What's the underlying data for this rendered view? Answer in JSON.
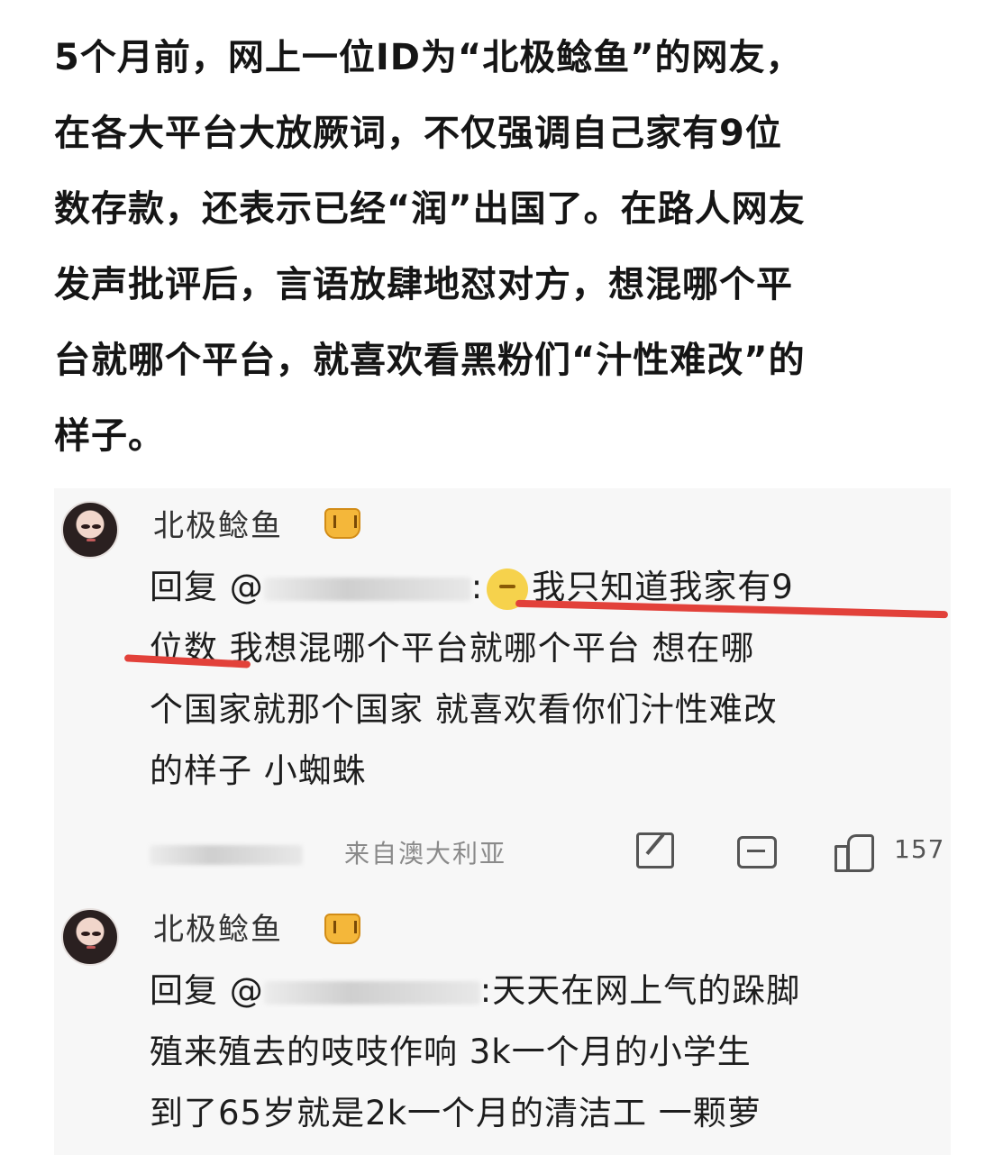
{
  "article": {
    "lines": [
      "5个月前，网上一位ID为“北极鲶鱼”的网友，",
      "在各大平台大放厥词，不仅强调自己家有9位",
      "数存款，还表示已经“润”出国了。在路人网友",
      "发声批评后，言语放肆地怼对方，想混哪个平",
      "台就哪个平台，就喜欢看黑粉们“汁性难改”的",
      "样子。"
    ]
  },
  "comments": [
    {
      "username": "北极鲶鱼",
      "reply_prefix": "回复 @",
      "reply_suffix": ":",
      "lines": [
        "我只知道我家有9",
        "位数 我想混哪个平台就哪个平台 想在哪",
        "个国家就那个国家 就喜欢看你们汁性难改",
        "的样子 小蜘蛛"
      ],
      "location": "来自澳大利亚",
      "likes": "157"
    },
    {
      "username": "北极鲶鱼",
      "reply_prefix": "回复 @",
      "reply_suffix": ":天天在网上气的跺脚",
      "lines": [
        "殖来殖去的吱吱作响 3k一个月的小学生",
        "到了65岁就是2k一个月的清洁工 一颗萝"
      ]
    }
  ],
  "colors": {
    "highlight_underline": "#e2413a",
    "badge": "#f4b73a"
  }
}
